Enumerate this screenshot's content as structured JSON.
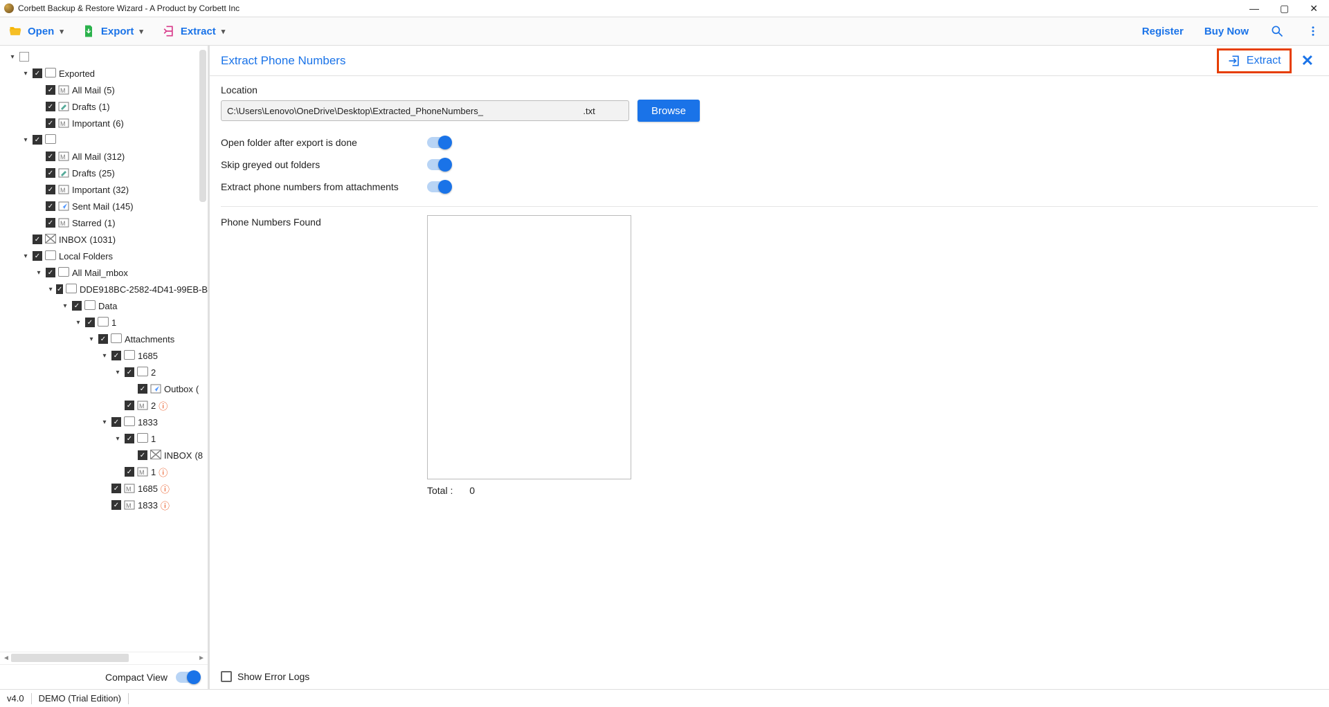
{
  "window": {
    "title": "Corbett Backup & Restore Wizard - A Product by Corbett Inc"
  },
  "toolbar": {
    "open": "Open",
    "export": "Export",
    "extract": "Extract",
    "register": "Register",
    "buy": "Buy Now"
  },
  "sidebar": {
    "compact": "Compact View",
    "nodes": [
      {
        "depth": 0,
        "arrow": "▾",
        "cbEmpty": true,
        "icon": "",
        "label": ""
      },
      {
        "depth": 1,
        "arrow": "▾",
        "cb": true,
        "icon": "folder",
        "label": "Exported"
      },
      {
        "depth": 2,
        "arrow": "",
        "cb": true,
        "icon": "mbox",
        "label": "All Mail",
        "count": "(5)"
      },
      {
        "depth": 2,
        "arrow": "",
        "cb": true,
        "icon": "draft",
        "label": "Drafts",
        "count": "(1)"
      },
      {
        "depth": 2,
        "arrow": "",
        "cb": true,
        "icon": "mbox",
        "label": "Important",
        "count": "(6)"
      },
      {
        "depth": 1,
        "arrow": "▾",
        "cb": true,
        "icon": "folder",
        "label": ""
      },
      {
        "depth": 2,
        "arrow": "",
        "cb": true,
        "icon": "mbox",
        "label": "All Mail",
        "count": "(312)"
      },
      {
        "depth": 2,
        "arrow": "",
        "cb": true,
        "icon": "draft",
        "label": "Drafts",
        "count": "(25)"
      },
      {
        "depth": 2,
        "arrow": "",
        "cb": true,
        "icon": "mbox",
        "label": "Important",
        "count": "(32)"
      },
      {
        "depth": 2,
        "arrow": "",
        "cb": true,
        "icon": "sent",
        "label": "Sent Mail",
        "count": "(145)"
      },
      {
        "depth": 2,
        "arrow": "",
        "cb": true,
        "icon": "mbox",
        "label": "Starred",
        "count": "(1)"
      },
      {
        "depth": 1,
        "arrow": "",
        "cb": true,
        "icon": "mail",
        "label": "INBOX",
        "count": "(1031)"
      },
      {
        "depth": 1,
        "arrow": "▾",
        "cb": true,
        "icon": "folder",
        "label": "Local Folders"
      },
      {
        "depth": 2,
        "arrow": "▾",
        "cb": true,
        "icon": "folder",
        "label": "All Mail_mbox"
      },
      {
        "depth": 3,
        "arrow": "▾",
        "cb": true,
        "icon": "folder",
        "label": "DDE918BC-2582-4D41-99EB-B"
      },
      {
        "depth": 4,
        "arrow": "▾",
        "cb": true,
        "icon": "folder",
        "label": "Data"
      },
      {
        "depth": 5,
        "arrow": "▾",
        "cb": true,
        "icon": "folder",
        "label": "1"
      },
      {
        "depth": 6,
        "arrow": "▾",
        "cb": true,
        "icon": "folder",
        "label": "Attachments"
      },
      {
        "depth": 7,
        "arrow": "▾",
        "cb": true,
        "icon": "folder",
        "label": "1685"
      },
      {
        "depth": 8,
        "arrow": "▾",
        "cb": true,
        "icon": "folder",
        "label": "2"
      },
      {
        "depth": 9,
        "arrow": "",
        "cb": true,
        "icon": "sent",
        "label": "Outbox",
        "count": "("
      },
      {
        "depth": 8,
        "arrow": "",
        "cb": true,
        "icon": "mbox",
        "label": "2",
        "warn": true
      },
      {
        "depth": 7,
        "arrow": "▾",
        "cb": true,
        "icon": "folder",
        "label": "1833"
      },
      {
        "depth": 8,
        "arrow": "▾",
        "cb": true,
        "icon": "folder",
        "label": "1"
      },
      {
        "depth": 9,
        "arrow": "",
        "cb": true,
        "icon": "mail",
        "label": "INBOX",
        "count": "(8"
      },
      {
        "depth": 8,
        "arrow": "",
        "cb": true,
        "icon": "mbox",
        "label": "1",
        "warn": true
      },
      {
        "depth": 7,
        "arrow": "",
        "cb": true,
        "icon": "mbox",
        "label": "1685",
        "warn": true
      },
      {
        "depth": 7,
        "arrow": "",
        "cb": true,
        "icon": "mbox",
        "label": "1833",
        "warn": true
      }
    ]
  },
  "main": {
    "title": "Extract Phone Numbers",
    "extract_btn": "Extract",
    "location_label": "Location",
    "location_value": "C:\\Users\\Lenovo\\OneDrive\\Desktop\\Extracted_PhoneNumbers_                                        .txt",
    "browse": "Browse",
    "opt1": "Open folder after export is done",
    "opt2": "Skip greyed out folders",
    "opt3": "Extract phone numbers from attachments",
    "found_label": "Phone Numbers Found",
    "total_label": "Total :",
    "total_value": "0",
    "errorlogs": "Show Error Logs"
  },
  "status": {
    "version": "v4.0",
    "edition": "DEMO (Trial Edition)"
  }
}
